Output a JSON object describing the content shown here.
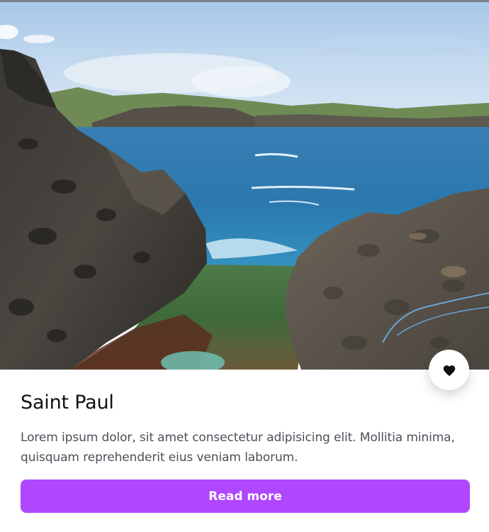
{
  "card": {
    "title": "Saint Paul",
    "description": "Lorem ipsum dolor, sit amet consectetur adipisicing elit. Mollitia minima, quisquam reprehenderit eius veniam laborum.",
    "read_more_label": "Read more",
    "image_subject": "rocky coastline and turquoise sea",
    "favorite_icon": "heart-icon",
    "colors": {
      "accent": "#b047ff",
      "title": "#111111",
      "text": "#4a5058"
    }
  }
}
